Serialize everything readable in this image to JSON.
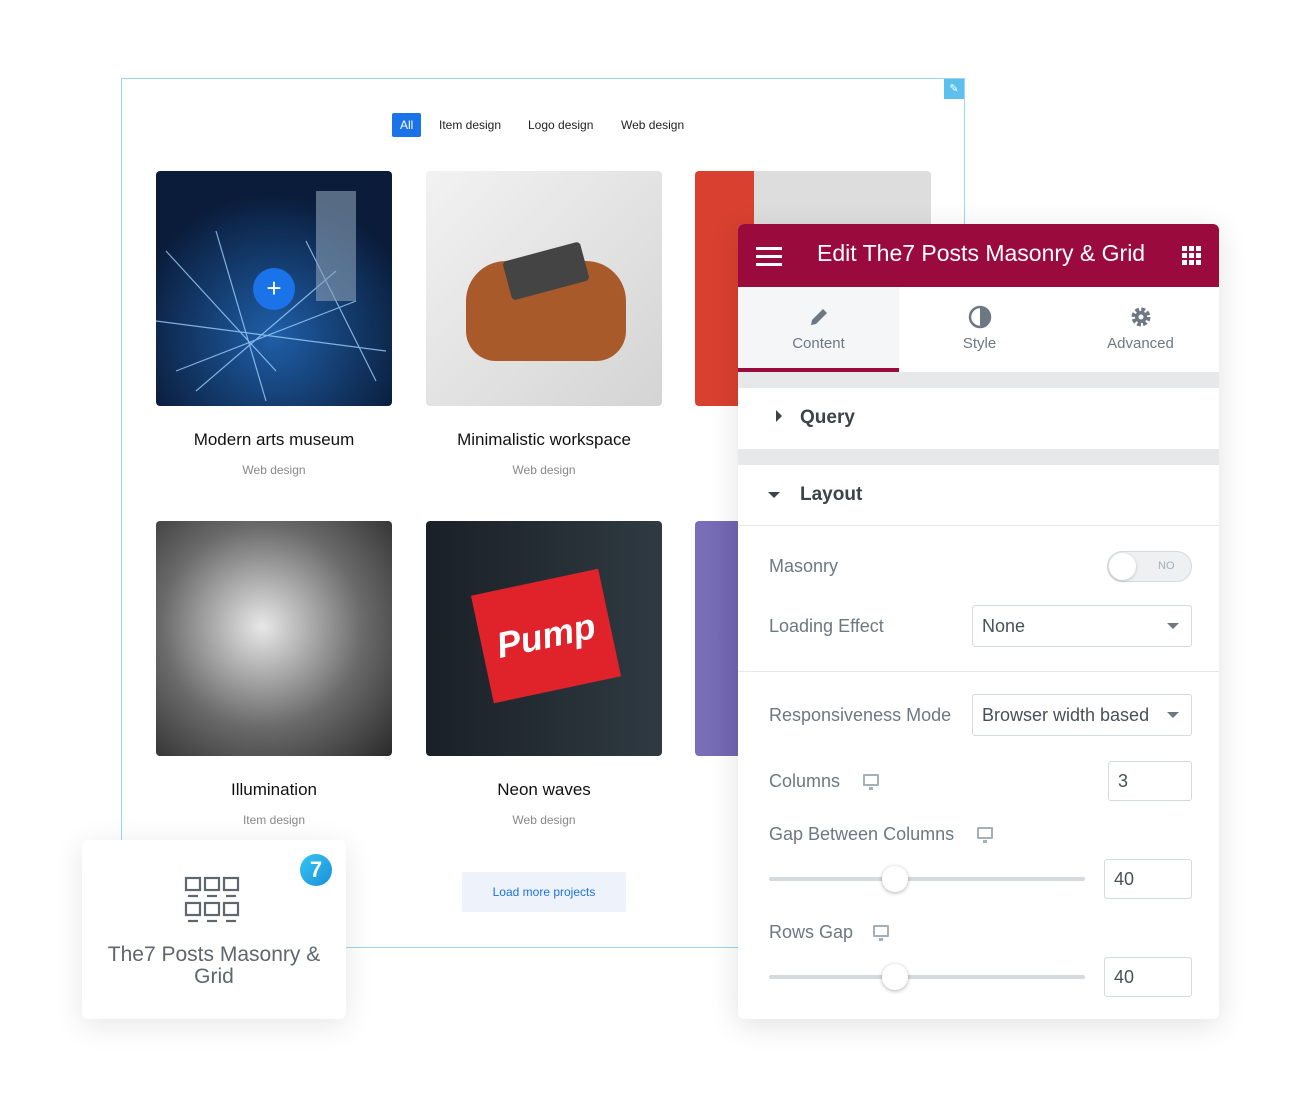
{
  "preview": {
    "filters": [
      "All",
      "Item design",
      "Logo design",
      "Web design"
    ],
    "active_filter": "All",
    "cards": [
      {
        "title": "Modern arts museum",
        "category": "Web design"
      },
      {
        "title": "Minimalistic workspace",
        "category": "Web design"
      },
      {
        "title": "",
        "category": ""
      },
      {
        "title": "Illumination",
        "category": "Item design"
      },
      {
        "title": "Neon waves",
        "category": "Web design"
      },
      {
        "title": "",
        "category": ""
      }
    ],
    "sign_text": "Pump",
    "load_more_label": "Load more projects",
    "accent_color": "#1a73e8"
  },
  "panel": {
    "title": "Edit The7 Posts Masonry & Grid",
    "header_color": "#9b0a3d",
    "tabs": [
      {
        "label": "Content",
        "icon": "pencil-icon",
        "active": true
      },
      {
        "label": "Style",
        "icon": "half-circle-icon",
        "active": false
      },
      {
        "label": "Advanced",
        "icon": "gear-icon",
        "active": false
      }
    ],
    "sections": {
      "query": "Query",
      "layout": "Layout"
    },
    "masonry": {
      "label": "Masonry",
      "toggle_text": "NO",
      "enabled": false
    },
    "loading_effect": {
      "label": "Loading Effect",
      "value": "None"
    },
    "responsiveness": {
      "label": "Responsiveness Mode",
      "value": "Browser width based"
    },
    "columns": {
      "label": "Columns",
      "value": "3"
    },
    "gap_columns": {
      "label": "Gap Between Columns",
      "value": "40"
    },
    "rows_gap": {
      "label": "Rows Gap",
      "value": "40"
    }
  },
  "widget": {
    "label": "The7 Posts Masonry & Grid",
    "badge": "7"
  }
}
